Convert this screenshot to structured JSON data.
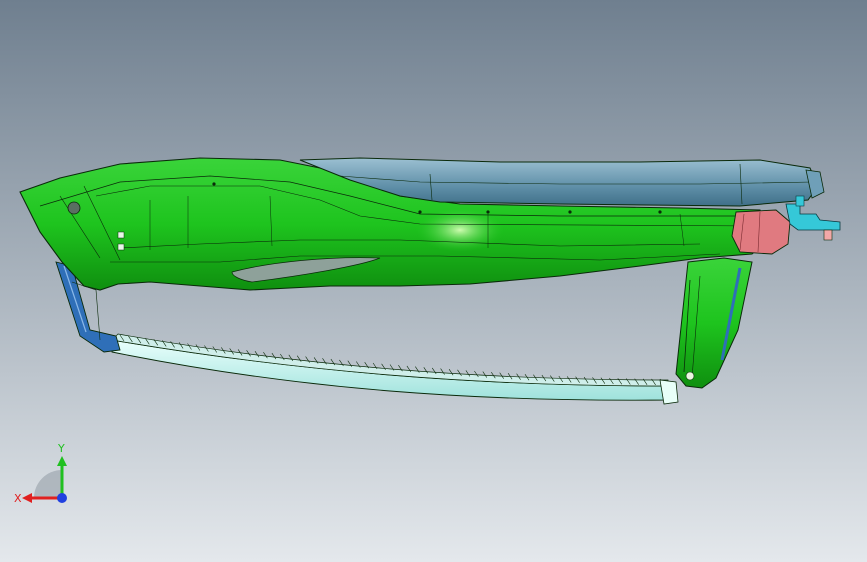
{
  "viewport": {
    "background_top": "#6f7f8f",
    "background_bottom": "#e4e8ec"
  },
  "model": {
    "colors": {
      "main_body": "#1fbe1f",
      "main_body_dark": "#128a12",
      "top_cover": "#5f8fa8",
      "top_cover_light": "#8fb6c8",
      "end_block": "#e07a80",
      "fitting": "#35c8d8",
      "lower_bar": "#c8f2ee",
      "side_trim": "#2f6fb8",
      "edge": "#0a2a0a"
    }
  },
  "triad": {
    "x_label": "X",
    "y_label": "Y",
    "x_color": "#e02020",
    "y_color": "#20c020",
    "z_color": "#2040e0"
  }
}
